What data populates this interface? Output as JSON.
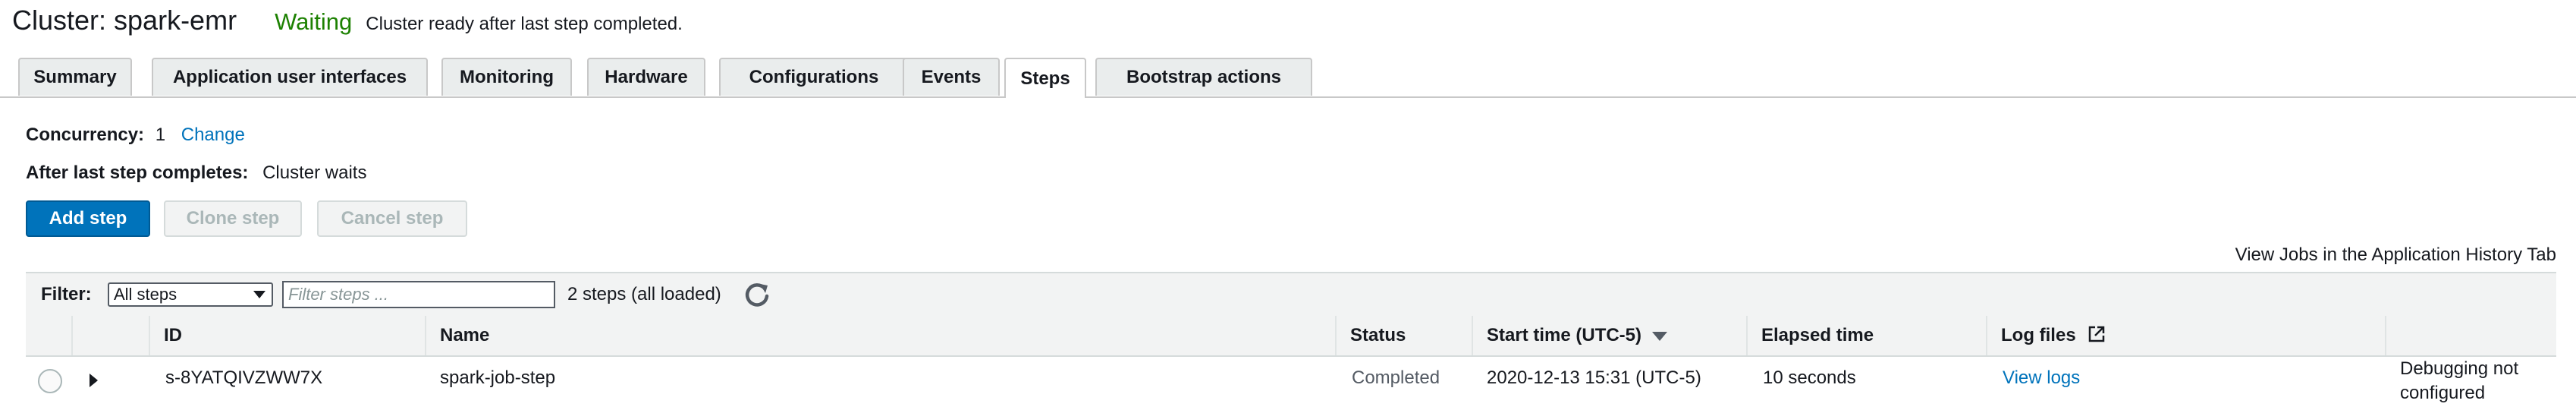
{
  "header": {
    "title": "Cluster: spark-emr",
    "status": "Waiting",
    "status_message": "Cluster ready after last step completed."
  },
  "tabs": [
    {
      "label": "Summary"
    },
    {
      "label": "Application user interfaces"
    },
    {
      "label": "Monitoring"
    },
    {
      "label": "Hardware"
    },
    {
      "label": "Configurations"
    },
    {
      "label": "Events"
    },
    {
      "label": "Steps",
      "active": true
    },
    {
      "label": "Bootstrap actions"
    }
  ],
  "settings": {
    "concurrency_label": "Concurrency:",
    "concurrency_value": "1",
    "change_link": "Change",
    "after_last_label": "After last step completes:",
    "after_last_value": "Cluster waits"
  },
  "actions": {
    "add_step": "Add step",
    "clone_step": "Clone step",
    "cancel_step": "Cancel step"
  },
  "view_jobs_link": "View Jobs in the Application History Tab",
  "filter": {
    "label": "Filter:",
    "selected": "All steps",
    "placeholder": "Filter steps ...",
    "count": "2 steps (all loaded)"
  },
  "table": {
    "columns": {
      "id": "ID",
      "name": "Name",
      "status": "Status",
      "start_time": "Start time (UTC-5)",
      "elapsed": "Elapsed time",
      "log_files": "Log files"
    },
    "rows": [
      {
        "id": "s-8YATQIVZWW7X",
        "name": "spark-job-step",
        "status": "Completed",
        "start_time": "2020-12-13 15:31 (UTC-5)",
        "elapsed": "10 seconds",
        "log_link": "View logs",
        "debug_line1": "Debugging not",
        "debug_line2": "configured"
      }
    ]
  },
  "colors": {
    "status_green": "#1d8102",
    "link_blue": "#0073bb",
    "primary_button": "#0073bb"
  }
}
